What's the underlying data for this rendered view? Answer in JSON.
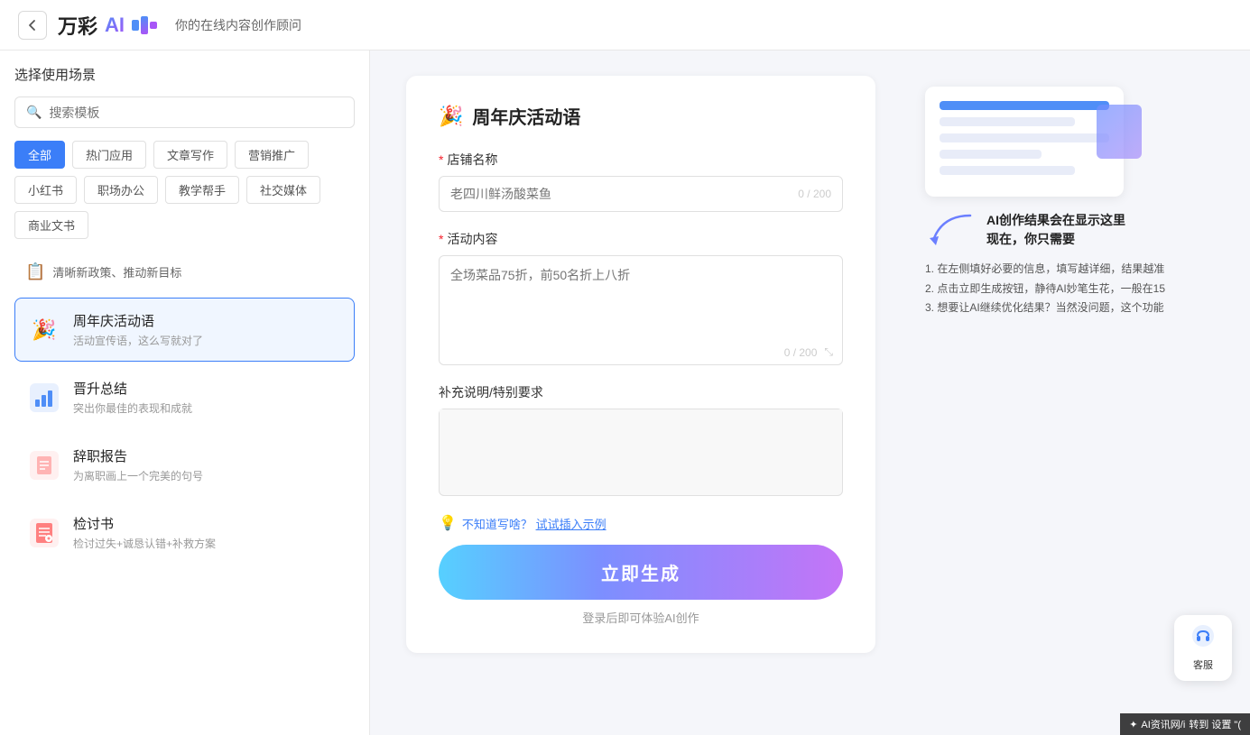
{
  "header": {
    "back_label": "‹",
    "logo_text": "万彩",
    "logo_ai": "AI",
    "subtitle": "你的在线内容创作顾问"
  },
  "sidebar": {
    "title": "选择使用场景",
    "search_placeholder": "搜索模板",
    "categories": [
      {
        "id": "all",
        "label": "全部",
        "active": true
      },
      {
        "id": "hot",
        "label": "热门应用",
        "active": false
      },
      {
        "id": "article",
        "label": "文章写作",
        "active": false
      },
      {
        "id": "marketing",
        "label": "营销推广",
        "active": false
      },
      {
        "id": "xiaohongshu",
        "label": "小红书",
        "active": false
      },
      {
        "id": "office",
        "label": "职场办公",
        "active": false
      },
      {
        "id": "teaching",
        "label": "教学帮手",
        "active": false
      },
      {
        "id": "social",
        "label": "社交媒体",
        "active": false
      },
      {
        "id": "business",
        "label": "商业文书",
        "active": false
      }
    ],
    "promo": {
      "icon": "📋",
      "text": "清晰新政策、推动新目标"
    },
    "items": [
      {
        "id": "anniversary",
        "icon": "🎉",
        "title": "周年庆活动语",
        "desc": "活动宣传语，这么写就对了",
        "active": true
      },
      {
        "id": "promotion",
        "icon": "📊",
        "title": "晋升总结",
        "desc": "突出你最佳的表现和成就",
        "active": false
      },
      {
        "id": "resignation",
        "icon": "📝",
        "title": "辞职报告",
        "desc": "为离职画上一个完美的句号",
        "active": false
      },
      {
        "id": "review",
        "icon": "📋",
        "title": "检讨书",
        "desc": "检讨过失+诚恳认错+补救方案",
        "active": false
      }
    ]
  },
  "form": {
    "title": "周年庆活动语",
    "title_icon": "🎉",
    "fields": {
      "store_name": {
        "label": "店铺名称",
        "required": true,
        "placeholder": "老四川鲜汤酸菜鱼",
        "char_count": "0 / 200"
      },
      "activity_content": {
        "label": "活动内容",
        "required": true,
        "placeholder": "全场菜品75折，前50名折上八折",
        "char_count": "0 / 200"
      },
      "supplement": {
        "label": "补充说明/特别要求",
        "required": false,
        "placeholder": ""
      }
    },
    "hint": {
      "icon": "💡",
      "text_prefix": "不知道写啥？",
      "text_link": "试试插入示例"
    },
    "generate_btn": "立即生成",
    "login_hint": "登录后即可体验AI创作"
  },
  "illustration": {
    "annotation_title": "AI创作结果会在显示这里",
    "annotation_subtitle": "现在，你只需要",
    "steps": [
      "1. 在左侧填好必要的信息，填写越详细，结果越准",
      "2. 点击立即生成按钮，静待AI妙笔生花，一般在15",
      "3. 想要让AI继续优化结果？当然没问题，这个功能"
    ]
  },
  "customer_service": {
    "icon": "☎",
    "label": "客服"
  },
  "watermark": {
    "text": "AI资讯网/i",
    "suffix": "转到 设置 \"("
  }
}
